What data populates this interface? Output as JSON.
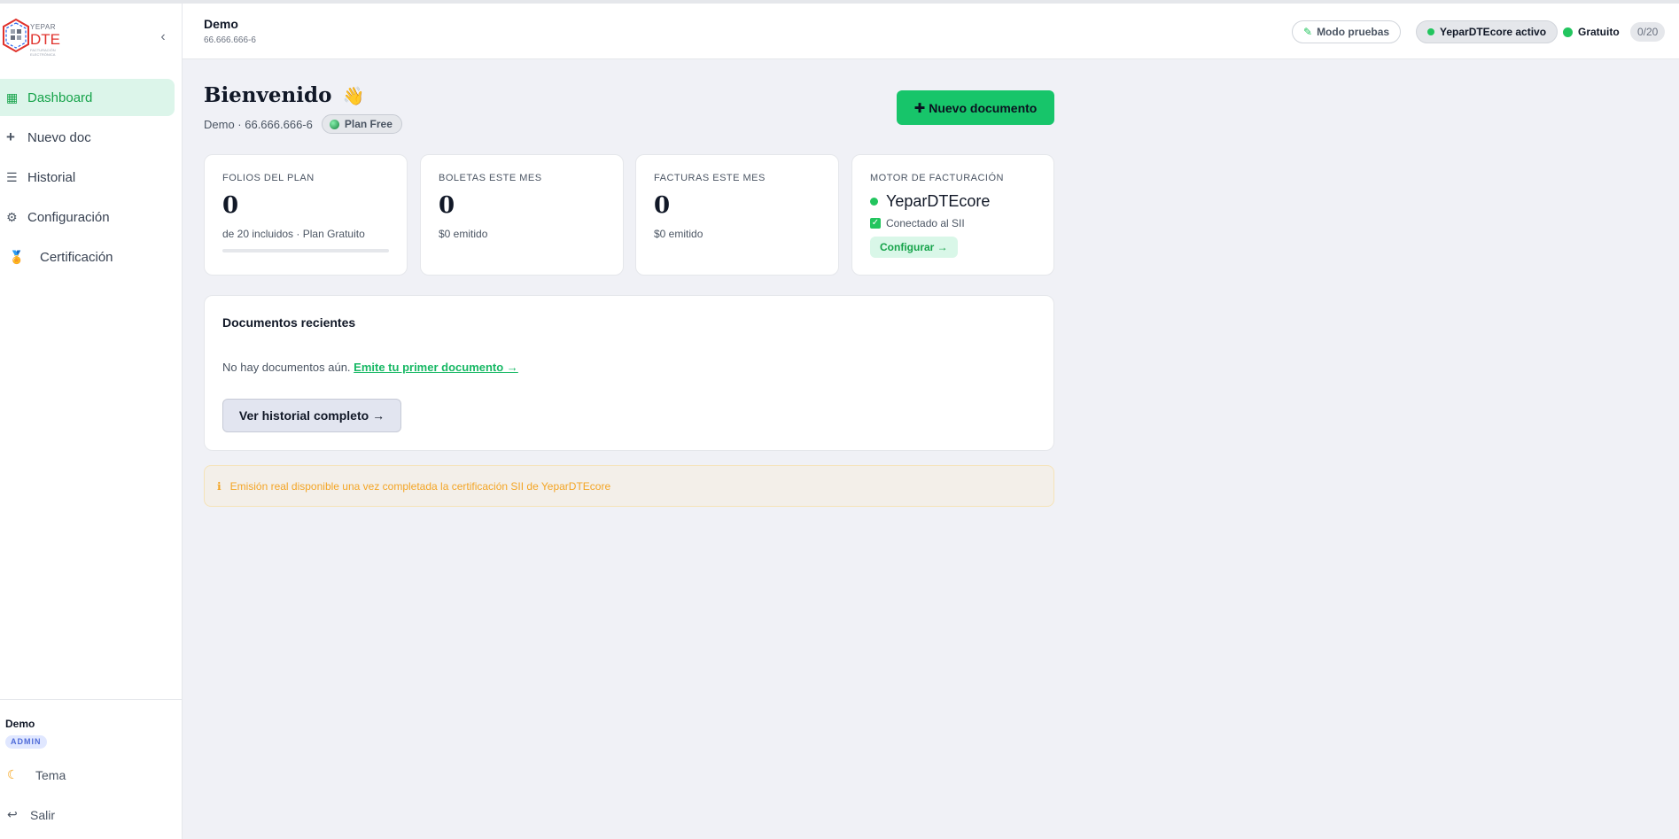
{
  "sidebar": {
    "logo": {
      "small_text": "YEPAR",
      "brand": "DTE",
      "tagline": "FACTURACIÓN ELECTRÓNICA"
    },
    "collapse_icon": "chevron-left-icon",
    "items": [
      {
        "label": "Dashboard",
        "icon": "grid-icon",
        "active": true
      },
      {
        "label": "Nuevo doc",
        "icon": "plus-icon",
        "active": false
      },
      {
        "label": "Historial",
        "icon": "list-icon",
        "active": false
      },
      {
        "label": "Configuración",
        "icon": "gear-icon",
        "active": false
      },
      {
        "label": "Certificación",
        "icon": "medal-icon",
        "active": false
      }
    ],
    "footer": {
      "user": "Demo",
      "role": "ADMIN",
      "theme_label": "Tema",
      "logout_label": "Salir"
    }
  },
  "topbar": {
    "company": "Demo",
    "rut": "66.666.666-6",
    "test_mode": "Modo pruebas",
    "engine_status": "YeparDTEcore activo",
    "plan": "Gratuito",
    "usage": "0/20"
  },
  "main": {
    "welcome": "Bienvenido",
    "welcome_emoji": "👋",
    "subline": "Demo · 66.666.666-6",
    "plan_badge": "Plan Free",
    "new_doc_button": "Nuevo documento",
    "cards": [
      {
        "label": "FOLIOS DEL PLAN",
        "value": "0",
        "sub": "de 20 incluidos · Plan Gratuito",
        "progress": 0
      },
      {
        "label": "BOLETAS ESTE MES",
        "value": "0",
        "sub": "$0 emitido"
      },
      {
        "label": "FACTURAS ESTE MES",
        "value": "0",
        "sub": "$0 emitido"
      },
      {
        "label": "MOTOR DE FACTURACIÓN",
        "engine": "YeparDTEcore",
        "connected": "Conectado al SII",
        "config_button": "Configurar →"
      }
    ],
    "recent": {
      "title": "Documentos recientes",
      "empty_text": "No hay documentos aún.",
      "empty_link": "Emite tu primer documento →",
      "history_button": "Ver historial completo →"
    },
    "alert": {
      "icon": "info-icon",
      "text": "Emisión real disponible una vez completada la certificación SII de YeparDTEcore"
    }
  },
  "colors": {
    "accent": "#17c56a",
    "active_bg": "#dcf5ea",
    "alert_text": "#f3a525",
    "background": "#f0f1f6"
  }
}
